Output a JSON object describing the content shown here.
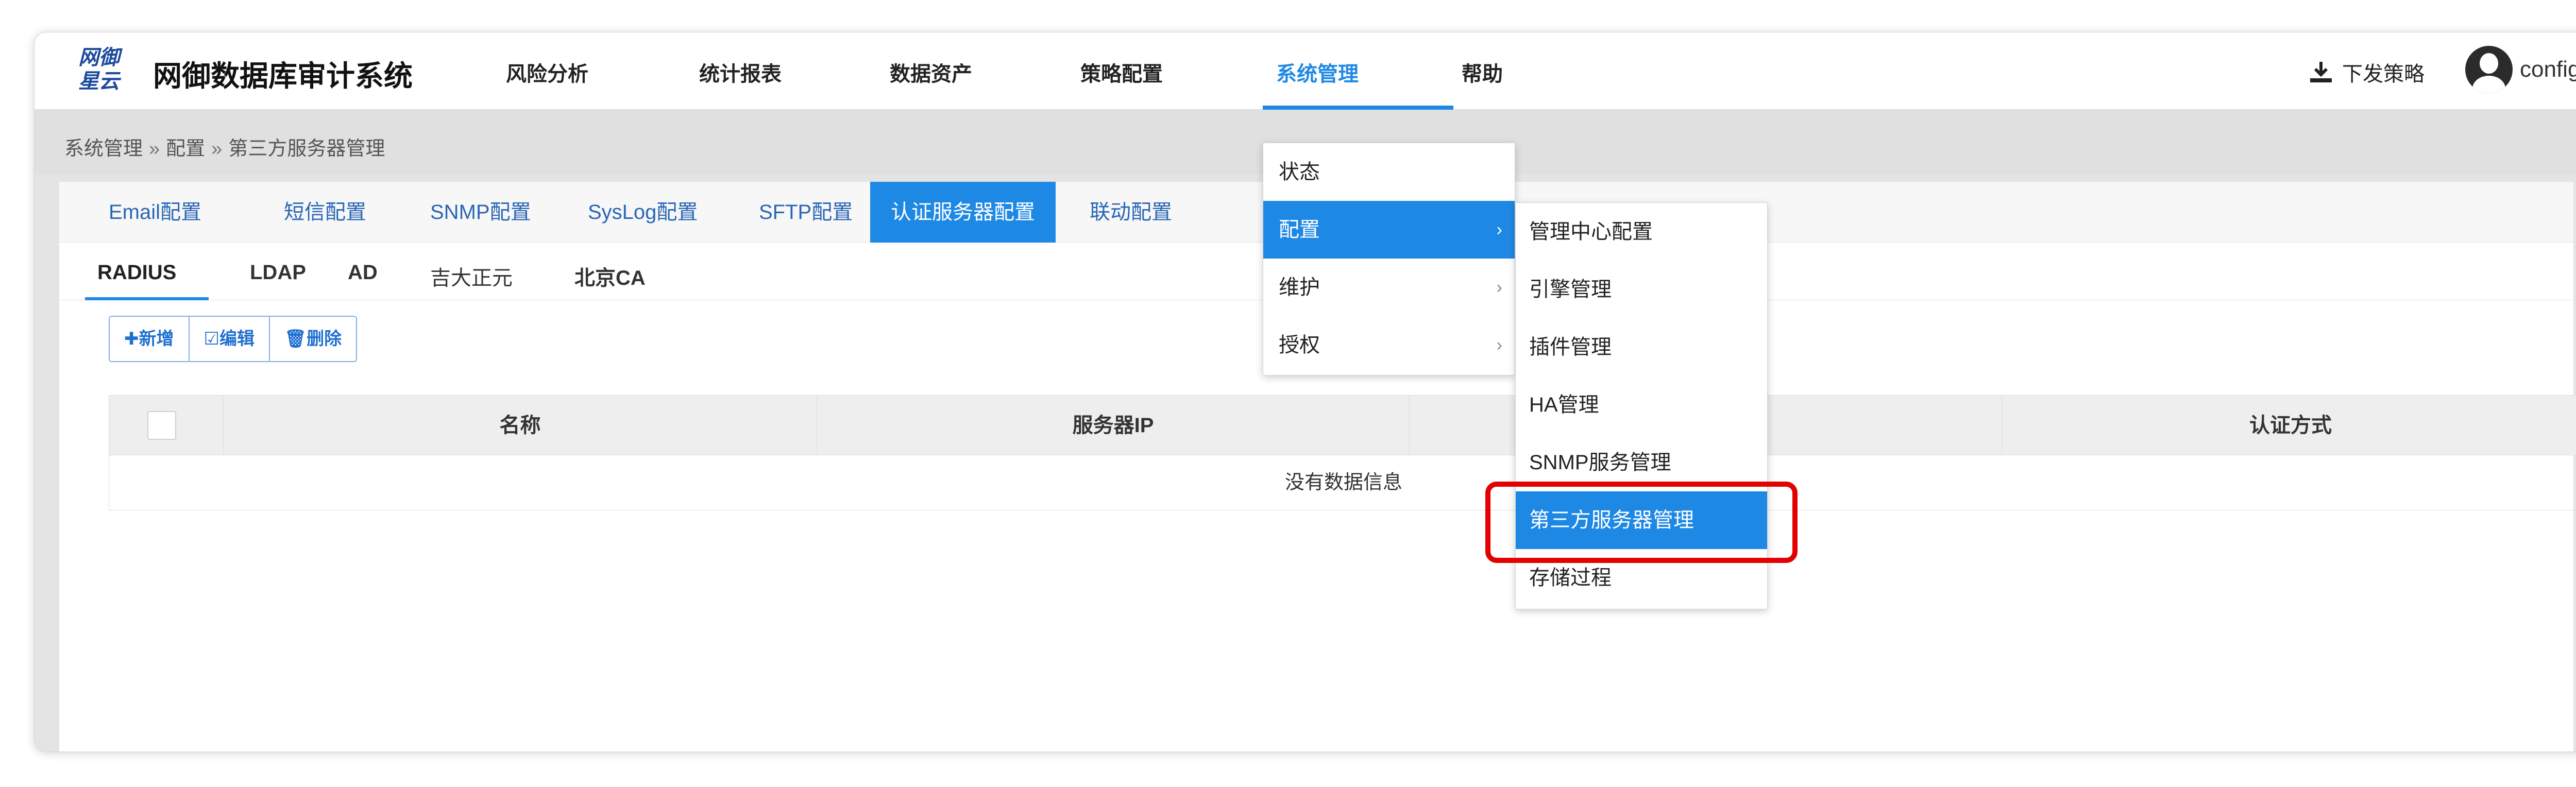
{
  "app": {
    "logo_line1": "网御",
    "logo_line2": "星云",
    "title": "网御数据库审计系统"
  },
  "nav": {
    "items": [
      {
        "label": "风险分析"
      },
      {
        "label": "统计报表"
      },
      {
        "label": "数据资产"
      },
      {
        "label": "策略配置"
      },
      {
        "label": "系统管理"
      },
      {
        "label": "帮助"
      }
    ],
    "active_index": 4,
    "download_label": "下发策略",
    "user_label": "config"
  },
  "breadcrumb": {
    "items": [
      "系统管理",
      "配置",
      "第三方服务器管理"
    ],
    "separator": "»"
  },
  "tabs": {
    "items": [
      "Email配置",
      "短信配置",
      "SNMP配置",
      "SysLog配置",
      "SFTP配置",
      "认证服务器配置",
      "联动配置"
    ],
    "active_index": 5
  },
  "subtabs": {
    "items": [
      "RADIUS",
      "LDAP",
      "AD",
      "吉大正元",
      "北京CA"
    ],
    "active_index": 0
  },
  "toolbar": {
    "add_label": "✚新增",
    "edit_label": "☑编辑",
    "delete_label": "🗑删除"
  },
  "table": {
    "columns": [
      "名称",
      "服务器IP",
      "",
      "认证方式"
    ],
    "empty_text": "没有数据信息"
  },
  "menu_level1": {
    "items": [
      {
        "label": "状态",
        "has_submenu": false
      },
      {
        "label": "配置",
        "has_submenu": true
      },
      {
        "label": "维护",
        "has_submenu": true
      },
      {
        "label": "授权",
        "has_submenu": true
      }
    ],
    "active_index": 1,
    "chevron": "›"
  },
  "menu_level2": {
    "items": [
      "管理中心配置",
      "引擎管理",
      "插件管理",
      "HA管理",
      "SNMP服务管理",
      "第三方服务器管理",
      "存储过程"
    ],
    "active_index": 5
  },
  "colors": {
    "accent": "#1e88e5",
    "highlight_ring": "#e30000"
  }
}
